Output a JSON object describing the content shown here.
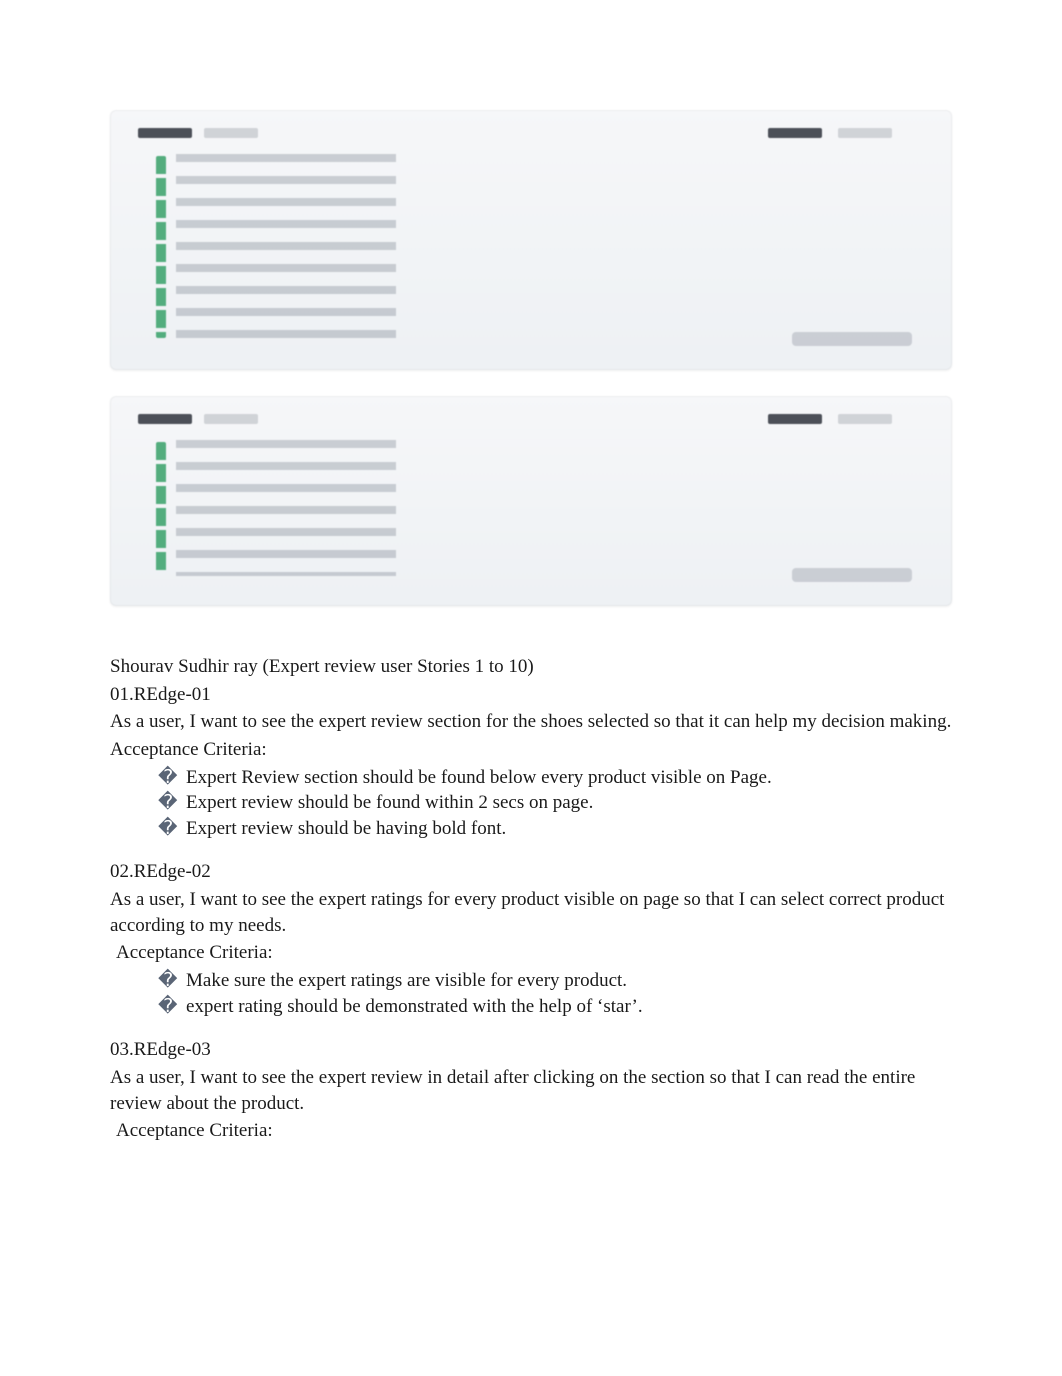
{
  "author_line": "Shourav Sudhir ray (Expert review user Stories 1 to 10)",
  "acceptance_label": "Acceptance Criteria:",
  "bullet_glyph": "�",
  "stories": [
    {
      "id": "01.REdge-01",
      "description": "As a user, I want to see the expert review section for the shoes selected so that it can help my decision making.",
      "acceptance_criteria": [
        "Expert Review section should be found below every product visible on Page.",
        "Expert review should be found within 2 secs on page.",
        "Expert review should be having bold font."
      ]
    },
    {
      "id": "02.REdge-02",
      "description": "As a user, I want to see the expert ratings for every product visible on page so that I can select correct product according to my needs.",
      "acceptance_criteria": [
        "Make sure the expert ratings are visible for every product.",
        "expert rating should be demonstrated with the help of ‘star’."
      ]
    },
    {
      "id": "03.REdge-03",
      "description": "As a user, I want to see the expert review in detail after clicking on the section so that I can read the entire review about the product.",
      "acceptance_criteria": []
    }
  ]
}
